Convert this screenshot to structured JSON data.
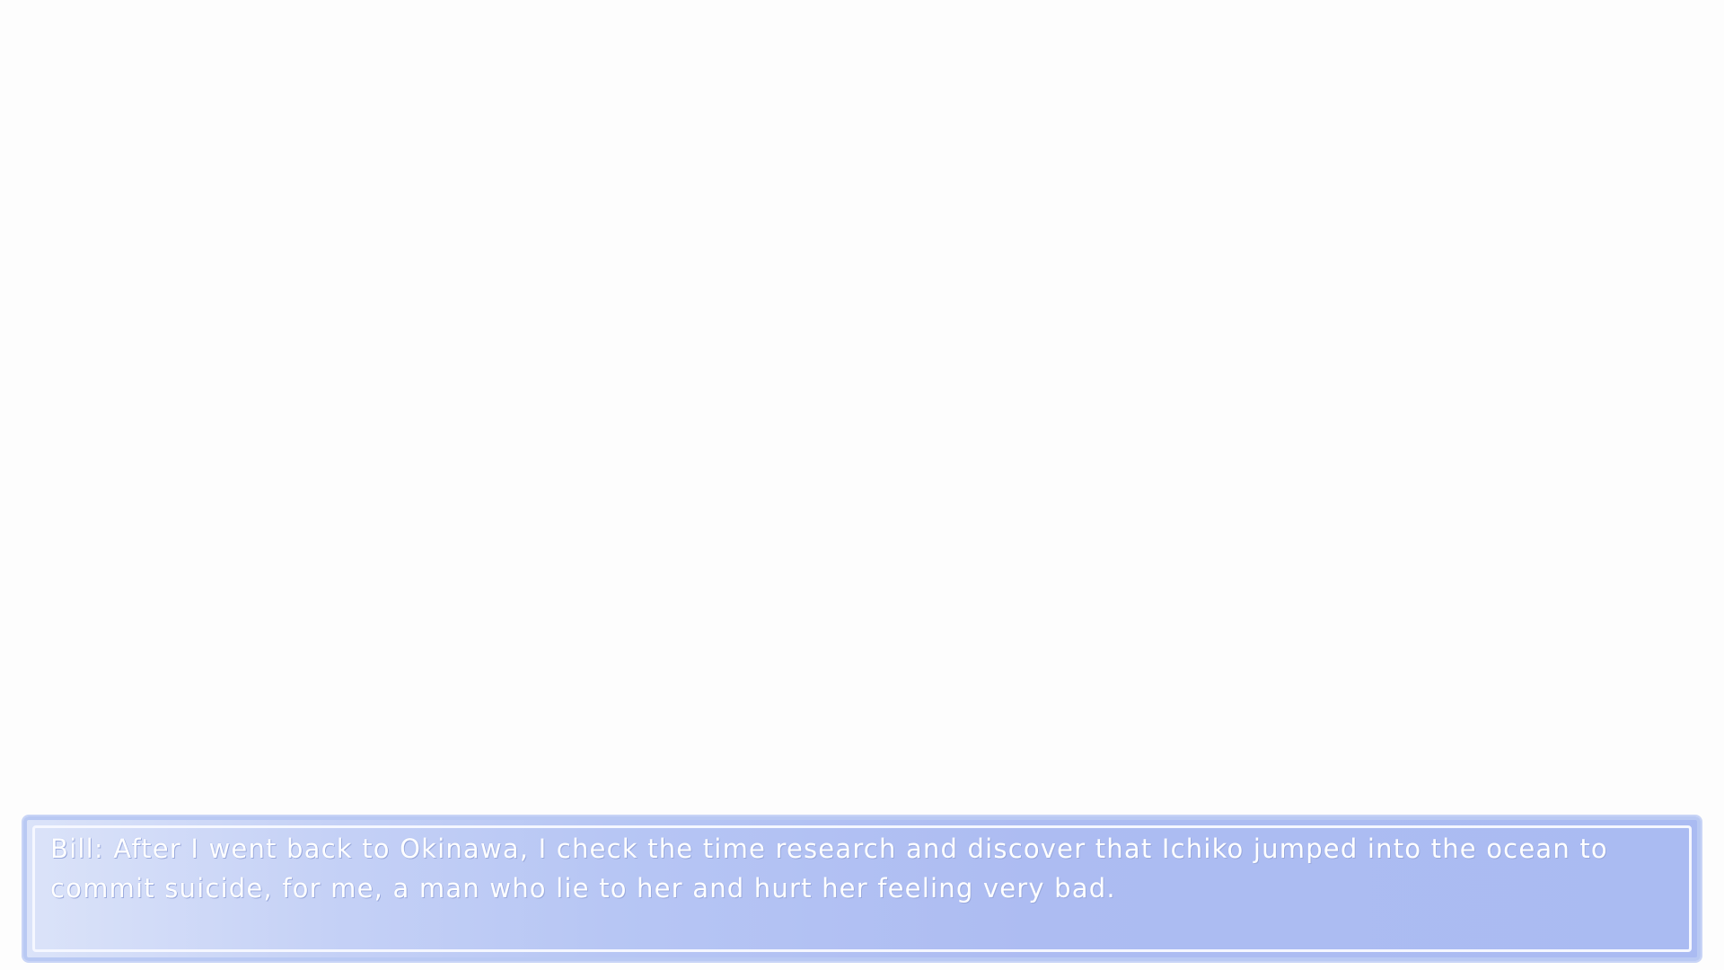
{
  "dialogue": {
    "text": "Bill: After I went back to Okinawa, I check the time research and discover that Ichiko jumped into the ocean to commit suicide, for me, a man who lie to her and hurt her feeling very bad."
  },
  "colors": {
    "background": "#fdfdfd",
    "box_gradient_start": "#dbe3f9",
    "box_gradient_end": "#aabbf2",
    "text": "#ffffff"
  }
}
